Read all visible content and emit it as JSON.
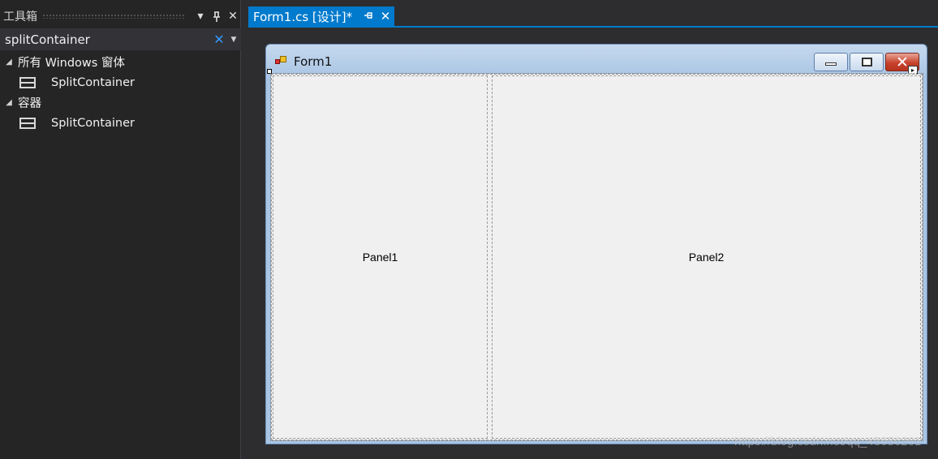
{
  "toolbox": {
    "title": "工具箱",
    "dropdown_icon": "triangle-down-icon",
    "pin_icon": "pin-icon",
    "close_icon": "close-icon",
    "search": {
      "value": "splitContainer"
    },
    "groups": [
      {
        "label": "所有 Windows 窗体",
        "items": [
          {
            "label": "SplitContainer",
            "icon": "splitcontainer-icon"
          }
        ]
      },
      {
        "label": "容器",
        "items": [
          {
            "label": "SplitContainer",
            "icon": "splitcontainer-icon"
          }
        ]
      }
    ]
  },
  "document": {
    "tab": {
      "label": "Form1.cs [设计]*",
      "active": true
    }
  },
  "form": {
    "title": "Form1",
    "panel1_label": "Panel1",
    "panel2_label": "Panel2"
  },
  "colors": {
    "accent": "#007acc",
    "ide_background": "#2d2d30",
    "toolbox_background": "#252526",
    "form_surface": "#f0f0f0",
    "close_button": "#c8432d"
  },
  "watermark": "https://blog.csdn.net/qq_43656261"
}
